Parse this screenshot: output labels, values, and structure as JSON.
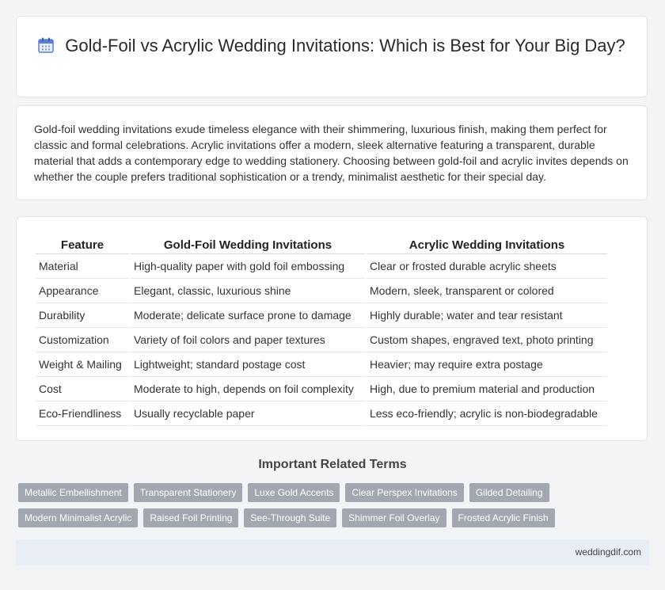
{
  "header": {
    "title": "Gold-Foil vs Acrylic Wedding Invitations: Which is Best for Your Big Day?",
    "icon": "calendar-icon"
  },
  "intro": {
    "text": "Gold-foil wedding invitations exude timeless elegance with their shimmering, luxurious finish, making them perfect for classic and formal celebrations. Acrylic invitations offer a modern, sleek alternative featuring a transparent, durable material that adds a contemporary edge to wedding stationery. Choosing between gold-foil and acrylic invites depends on whether the couple prefers traditional sophistication or a trendy, minimalist aesthetic for their special day."
  },
  "table": {
    "headers": [
      "Feature",
      "Gold-Foil Wedding Invitations",
      "Acrylic Wedding Invitations"
    ],
    "rows": [
      [
        "Material",
        "High-quality paper with gold foil embossing",
        "Clear or frosted durable acrylic sheets"
      ],
      [
        "Appearance",
        "Elegant, classic, luxurious shine",
        "Modern, sleek, transparent or colored"
      ],
      [
        "Durability",
        "Moderate; delicate surface prone to damage",
        "Highly durable; water and tear resistant"
      ],
      [
        "Customization",
        "Variety of foil colors and paper textures",
        "Custom shapes, engraved text, photo printing"
      ],
      [
        "Weight & Mailing",
        "Lightweight; standard postage cost",
        "Heavier; may require extra postage"
      ],
      [
        "Cost",
        "Moderate to high, depends on foil complexity",
        "High, due to premium material and production"
      ],
      [
        "Eco-Friendliness",
        "Usually recyclable paper",
        "Less eco-friendly; acrylic is non-biodegradable"
      ]
    ]
  },
  "related": {
    "title": "Important Related Terms",
    "tags_row1": [
      "Metallic Embellishment",
      "Transparent Stationery",
      "Luxe Gold Accents",
      "Clear Perspex Invitations",
      "Gilded Detailing"
    ],
    "tags_row2": [
      "Modern Minimalist Acrylic",
      "Raised Foil Printing",
      "See-Through Suite",
      "Shimmer Foil Overlay",
      "Frosted Acrylic Finish"
    ]
  },
  "footer": {
    "site": "weddingdif.com"
  },
  "colors": {
    "tag_bg": "#a3a8b0",
    "footer_bg": "#e9eef6",
    "icon_accent": "#5b7fd6"
  }
}
